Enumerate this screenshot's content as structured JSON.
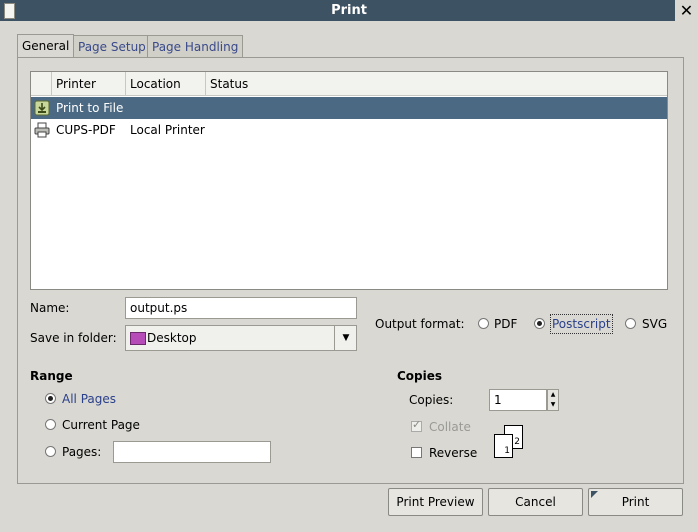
{
  "window": {
    "title": "Print"
  },
  "tabs": [
    {
      "label": "General"
    },
    {
      "label": "Page Setup"
    },
    {
      "label": "Page Handling"
    }
  ],
  "printer_list": {
    "columns": [
      "Printer",
      "Location",
      "Status"
    ],
    "rows": [
      {
        "printer": "Print to File",
        "location": "",
        "status": "",
        "icon": "print-to-file-icon",
        "selected": true
      },
      {
        "printer": "CUPS-PDF",
        "location": "Local Printer",
        "status": "",
        "icon": "printer-icon",
        "selected": false
      }
    ]
  },
  "name_field": {
    "label": "Name:",
    "value": "output.ps"
  },
  "folder_field": {
    "label": "Save in folder:",
    "value": "Desktop"
  },
  "output_format": {
    "label": "Output format:",
    "options": [
      "PDF",
      "Postscript",
      "SVG"
    ],
    "selected": "Postscript"
  },
  "range": {
    "heading": "Range",
    "options": [
      "All Pages",
      "Current Page",
      "Pages:"
    ],
    "selected": "All Pages",
    "pages_value": ""
  },
  "copies": {
    "heading": "Copies",
    "copies_label": "Copies:",
    "copies_value": "1",
    "collate_label": "Collate",
    "collate_checked": true,
    "collate_enabled": false,
    "reverse_label": "Reverse",
    "reverse_checked": false,
    "page_illustration": [
      "1",
      "2"
    ]
  },
  "buttons": {
    "preview": "Print Preview",
    "cancel": "Cancel",
    "print": "Print"
  },
  "colors": {
    "titlebar": "#3d5263",
    "selection": "#4b6983",
    "background": "#d9d8d2"
  }
}
